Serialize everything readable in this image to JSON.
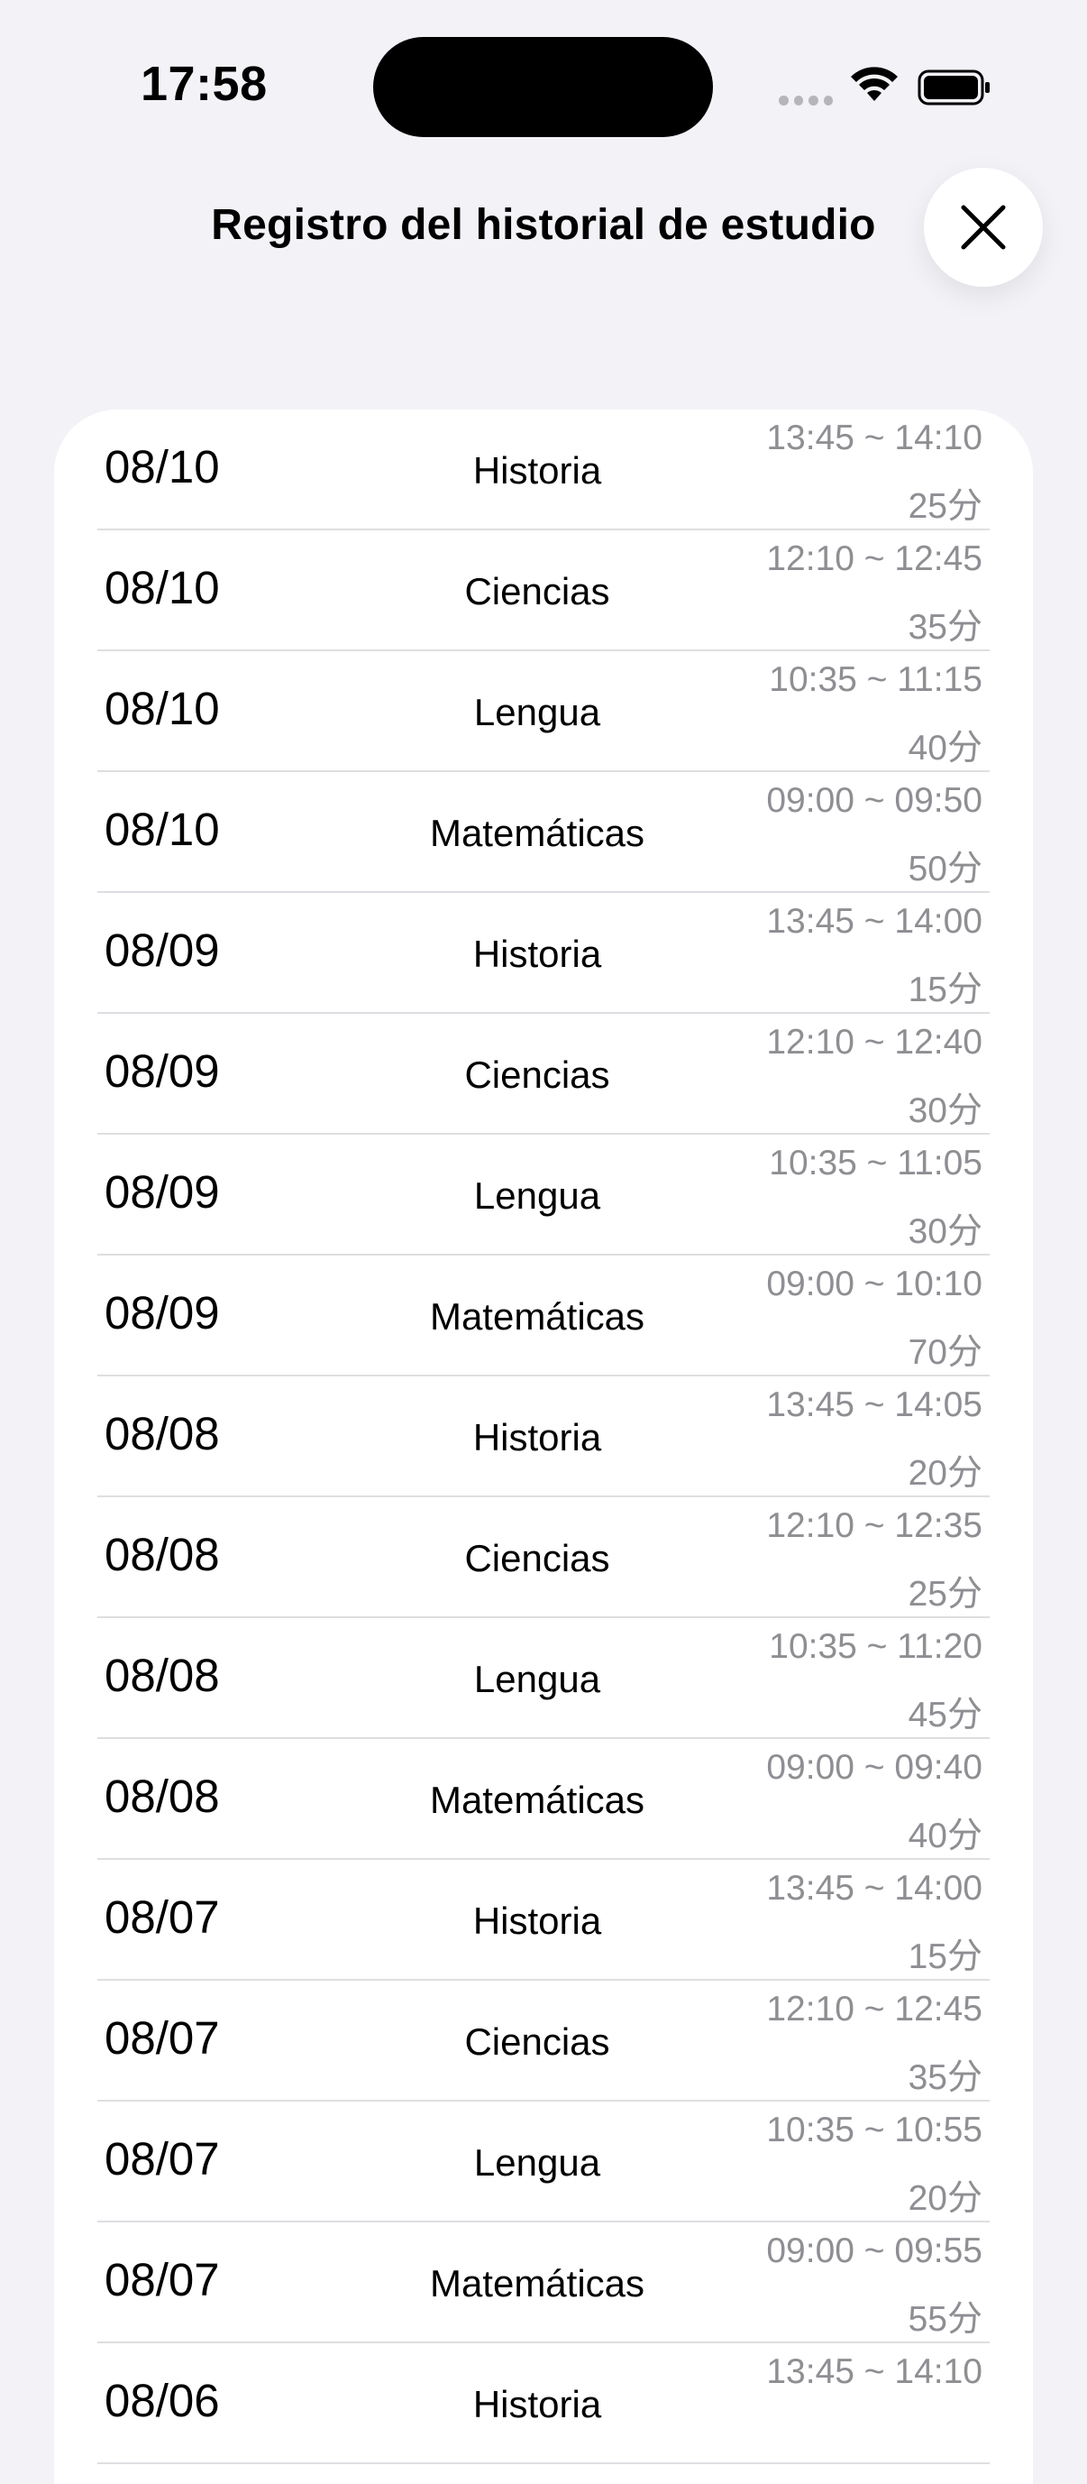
{
  "status_bar": {
    "time": "17:58",
    "icons": [
      "cellular-signal-icon",
      "wifi-icon",
      "battery-icon"
    ]
  },
  "header": {
    "title": "Registro del historial de estudio",
    "close_icon": "close-icon"
  },
  "records": [
    {
      "date": "08/10",
      "subject": "Historia",
      "time": "13:45 ~ 14:10",
      "duration": "25分"
    },
    {
      "date": "08/10",
      "subject": "Ciencias",
      "time": "12:10 ~ 12:45",
      "duration": "35分"
    },
    {
      "date": "08/10",
      "subject": "Lengua",
      "time": "10:35 ~ 11:15",
      "duration": "40分"
    },
    {
      "date": "08/10",
      "subject": "Matemáticas",
      "time": "09:00 ~ 09:50",
      "duration": "50分"
    },
    {
      "date": "08/09",
      "subject": "Historia",
      "time": "13:45 ~ 14:00",
      "duration": "15分"
    },
    {
      "date": "08/09",
      "subject": "Ciencias",
      "time": "12:10 ~ 12:40",
      "duration": "30分"
    },
    {
      "date": "08/09",
      "subject": "Lengua",
      "time": "10:35 ~ 11:05",
      "duration": "30分"
    },
    {
      "date": "08/09",
      "subject": "Matemáticas",
      "time": "09:00 ~ 10:10",
      "duration": "70分"
    },
    {
      "date": "08/08",
      "subject": "Historia",
      "time": "13:45 ~ 14:05",
      "duration": "20分"
    },
    {
      "date": "08/08",
      "subject": "Ciencias",
      "time": "12:10 ~ 12:35",
      "duration": "25分"
    },
    {
      "date": "08/08",
      "subject": "Lengua",
      "time": "10:35 ~ 11:20",
      "duration": "45分"
    },
    {
      "date": "08/08",
      "subject": "Matemáticas",
      "time": "09:00 ~ 09:40",
      "duration": "40分"
    },
    {
      "date": "08/07",
      "subject": "Historia",
      "time": "13:45 ~ 14:00",
      "duration": "15分"
    },
    {
      "date": "08/07",
      "subject": "Ciencias",
      "time": "12:10 ~ 12:45",
      "duration": "35分"
    },
    {
      "date": "08/07",
      "subject": "Lengua",
      "time": "10:35 ~ 10:55",
      "duration": "20分"
    },
    {
      "date": "08/07",
      "subject": "Matemáticas",
      "time": "09:00 ~ 09:55",
      "duration": "55分"
    },
    {
      "date": "08/06",
      "subject": "Historia",
      "time": "13:45 ~ 14:10",
      "duration": ""
    }
  ]
}
